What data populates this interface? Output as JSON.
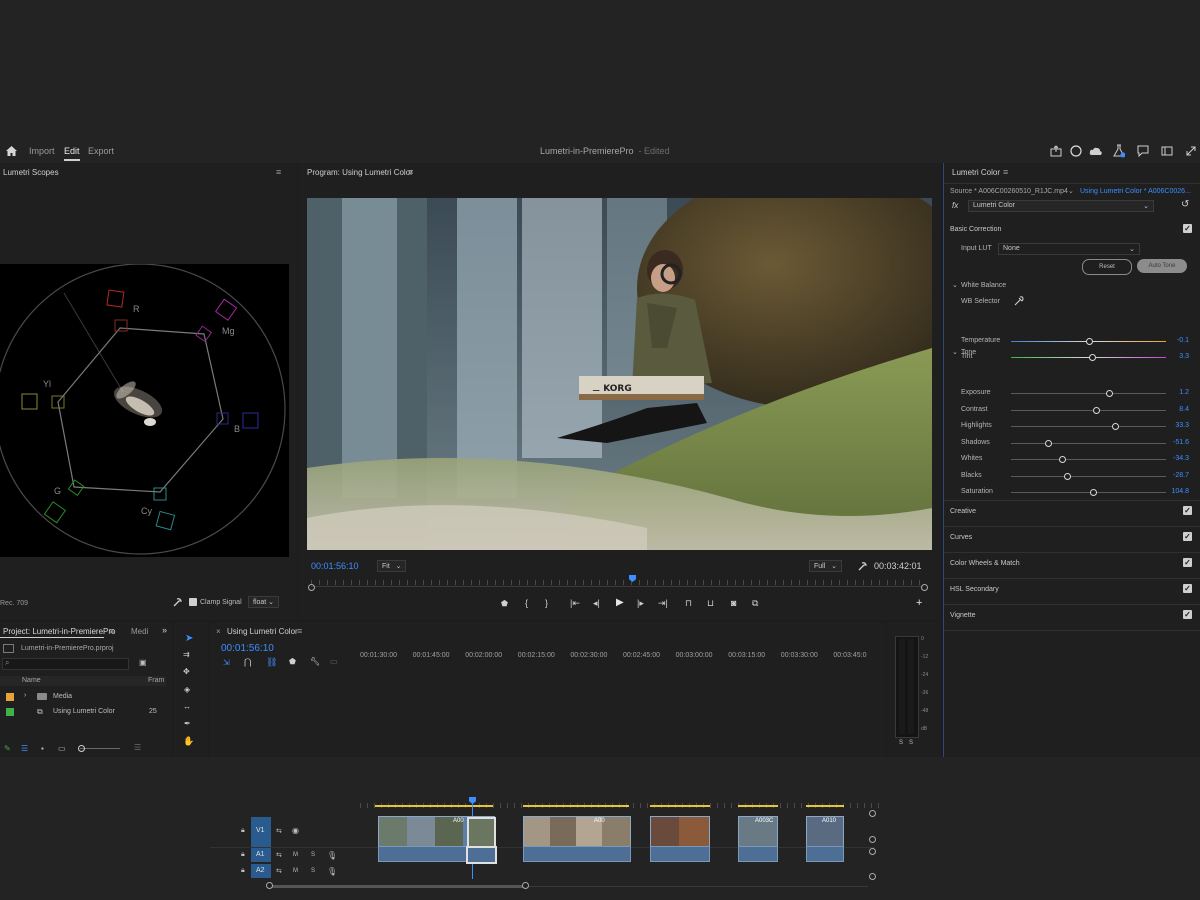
{
  "topbar": {
    "nav": [
      "Import",
      "Edit",
      "Export"
    ],
    "project_title": "Lumetri-in-PremierePro",
    "edited": "- Edited"
  },
  "scopes": {
    "title": "Lumetri Scopes",
    "labels": {
      "r": "R",
      "mg": "Mg",
      "yl": "Yl",
      "b": "B",
      "g": "G",
      "cy": "Cy"
    },
    "footer_left": "Rec. 709",
    "clamp_label": "Clamp Signal",
    "float_value": "float"
  },
  "program": {
    "title": "Program: Using Lumetri Color",
    "timecode_current": "00:01:56:10",
    "fit_value": "Fit",
    "quality_value": "Full",
    "timecode_duration": "00:03:42:01"
  },
  "lumetri": {
    "title": "Lumetri Color",
    "source_label": "Source * A006C00260510_R1JC.mp4",
    "sequence_label": "Using Lumetri Color * A006C0026...",
    "fx_name": "Lumetri Color",
    "basic_correction": "Basic Correction",
    "input_lut_label": "Input LUT",
    "input_lut_value": "None",
    "reset_label": "Reset",
    "auto_tone_label": "Auto Tone",
    "white_balance": "White Balance",
    "wb_selector": "WB Selector",
    "tone": "Tone",
    "sliders": [
      {
        "label": "Temperature",
        "value": "-0.1",
        "pos": 0.5
      },
      {
        "label": "Tint",
        "value": "3.3",
        "pos": 0.52
      },
      {
        "label": "Exposure",
        "value": "1.2",
        "pos": 0.63
      },
      {
        "label": "Contrast",
        "value": "8.4",
        "pos": 0.55
      },
      {
        "label": "Highlights",
        "value": "33.3",
        "pos": 0.67
      },
      {
        "label": "Shadows",
        "value": "-51.6",
        "pos": 0.24
      },
      {
        "label": "Whites",
        "value": "-34.3",
        "pos": 0.33
      },
      {
        "label": "Blacks",
        "value": "-28.7",
        "pos": 0.36
      },
      {
        "label": "Saturation",
        "value": "104.8",
        "pos": 0.53
      }
    ],
    "sections": [
      "Creative",
      "Curves",
      "Color Wheels & Match",
      "HSL Secondary",
      "Vignette"
    ]
  },
  "project": {
    "title": "Project: Lumetri-in-PremierePro",
    "tab2": "Medi",
    "file": "Lumetri-in-PremierePro.prproj",
    "col_name": "Name",
    "col_frame": "Fram",
    "items": [
      {
        "name": "Media",
        "frame": ""
      },
      {
        "name": "Using Lumetri Color",
        "frame": "25"
      }
    ]
  },
  "timeline": {
    "title": "Using Lumetri Color",
    "timecode": "00:01:56:10",
    "ruler": [
      "00:01:30:00",
      "00:01:45:00",
      "00:02:00:00",
      "00:02:15:00",
      "00:02:30:00",
      "00:02:45:00",
      "00:03:00:00",
      "00:03:15:00",
      "00:03:30:00",
      "00:03:45:0"
    ],
    "tracks": {
      "v1": "V1",
      "a1": "A1",
      "a2": "A2",
      "m": "M",
      "s": "S"
    },
    "clip_labels": [
      "A00",
      "A00",
      "A003C",
      "A010"
    ]
  },
  "meter": {
    "scale": [
      "0",
      "-12",
      "-24",
      "-36",
      "-48",
      "dB"
    ],
    "solo": [
      "S",
      "S"
    ]
  },
  "colors": {
    "accent": "#3d8fff",
    "panel": "#1f1f1f",
    "background": "#232323"
  }
}
